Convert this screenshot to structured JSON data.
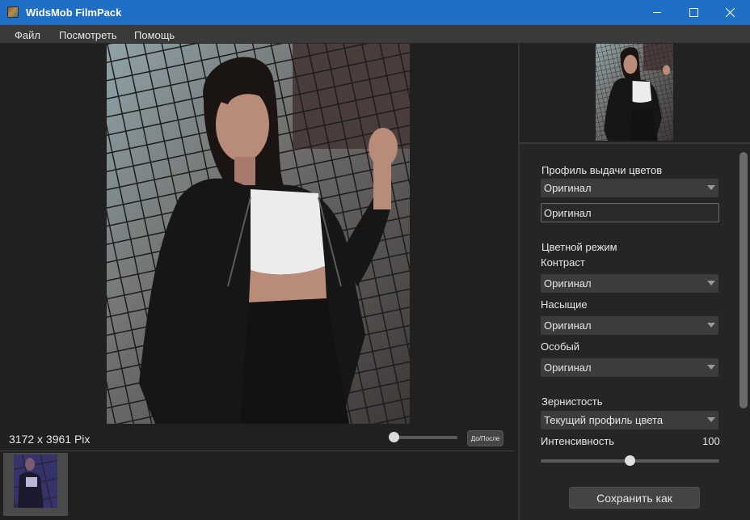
{
  "window": {
    "title": "WidsMob FilmPack",
    "minimize_icon": "minimize-icon",
    "maximize_icon": "maximize-icon",
    "close_icon": "close-icon"
  },
  "menu": {
    "items": [
      "Файл",
      "Посмотреть",
      "Помощь"
    ]
  },
  "workspace": {
    "image_size_text": "3172 x 3961 Pix",
    "before_after_label": "До/После",
    "before_after_position": 0.0
  },
  "panel": {
    "color_profile_label": "Профиль выдачи цветов",
    "color_profile_value": "Оригинал",
    "color_profile_field": "Оригинал",
    "color_mode_label": "Цветной режим",
    "contrast_label": "Контраст",
    "contrast_value": "Оригинал",
    "saturation_label": "Насыщие",
    "saturation_value": "Оригинал",
    "special_label": "Особый",
    "special_value": "Оригинал",
    "grain_label": "Зернистость",
    "grain_value": "Текущий профиль цвета",
    "intensity_label": "Интенсивность",
    "intensity_value": "100",
    "save_label": "Сохранить как"
  },
  "colors": {
    "titlebar": "#1f6fc7",
    "background": "#202020",
    "panel": "#252525"
  }
}
